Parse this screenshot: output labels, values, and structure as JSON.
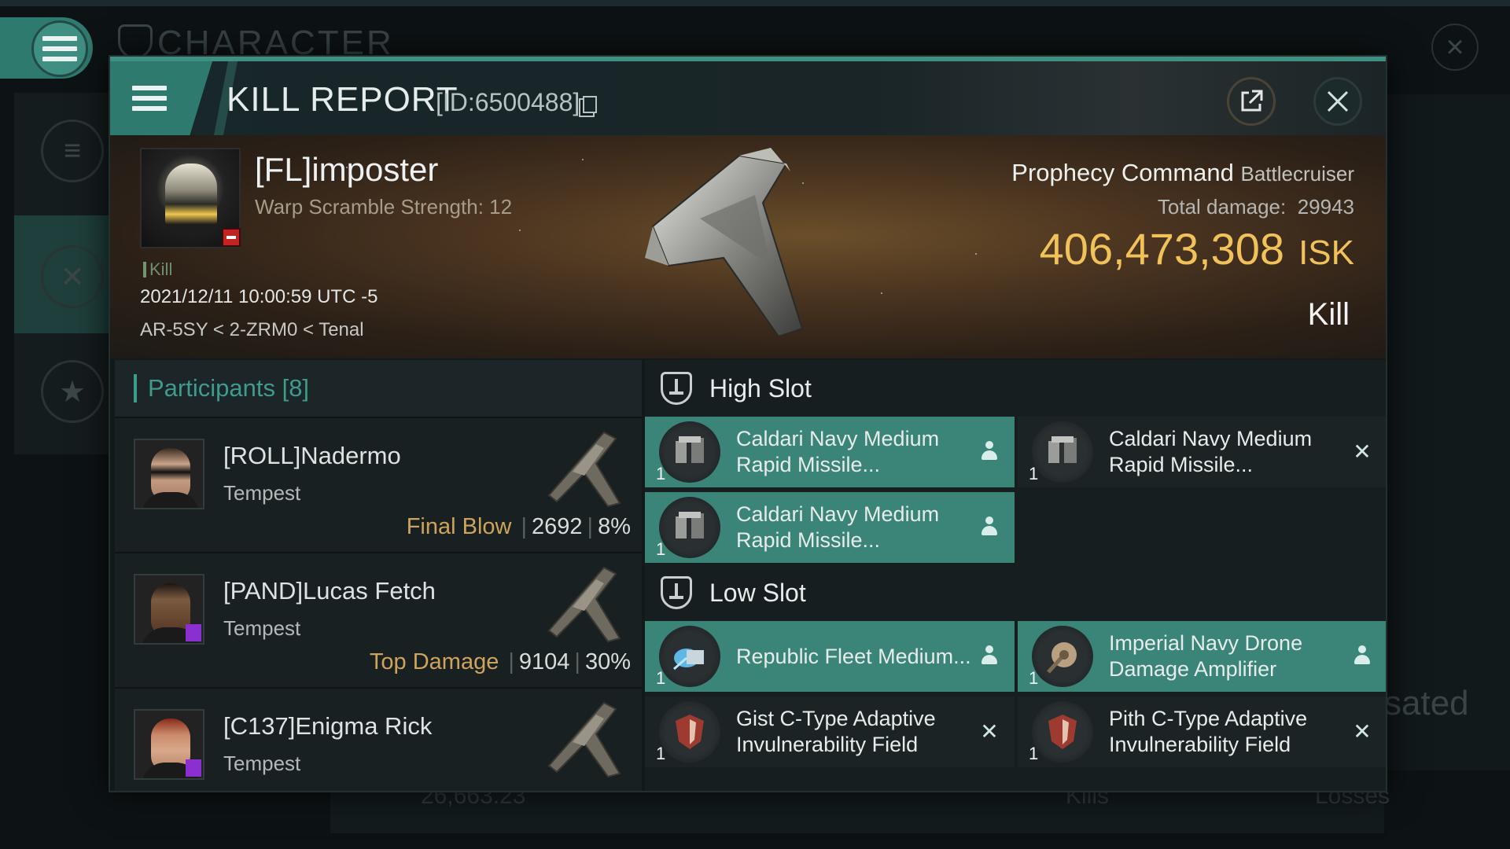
{
  "background": {
    "title": "CHARACTER",
    "right_text": "sated",
    "bottom_value": "26,663.23",
    "bottom_kills": "Kills",
    "bottom_losses": "Losses"
  },
  "header": {
    "title": "KILL REPORT",
    "id_text": "[ID:6500488]"
  },
  "victim": {
    "name": "[FL]imposter",
    "subtitle": "Warp Scramble Strength: 12",
    "tag": "Kill",
    "datetime": "2021/12/11 10:00:59 UTC -5",
    "location": "AR-5SY < 2-ZRM0 < Tenal",
    "ship_name": "Prophecy Command",
    "ship_class": "Battlecruiser",
    "total_damage_label": "Total damage:",
    "total_damage": "29943",
    "isk_value": "406,473,308",
    "isk_unit": "ISK",
    "result": "Kill"
  },
  "participants": {
    "header": "Participants [8]",
    "rows": [
      {
        "name": "[ROLL]Nadermo",
        "ship": "Tempest",
        "tag": "Final Blow",
        "damage": "2692",
        "percent": "8%"
      },
      {
        "name": "[PAND]Lucas Fetch",
        "ship": "Tempest",
        "tag": "Top Damage",
        "damage": "9104",
        "percent": "30%"
      },
      {
        "name": "[C137]Enigma Rick",
        "ship": "Tempest",
        "tag": "",
        "damage": "",
        "percent": ""
      }
    ]
  },
  "slots": {
    "high": {
      "title": "High Slot",
      "items": [
        {
          "name": "Caldari Navy Medium Rapid Missile...",
          "qty": "1",
          "state": "fitted"
        },
        {
          "name": "Caldari Navy Medium Rapid Missile...",
          "qty": "1",
          "state": "destroyed"
        },
        {
          "name": "Caldari Navy Medium Rapid Missile...",
          "qty": "1",
          "state": "fitted"
        }
      ]
    },
    "low": {
      "title": "Low Slot",
      "items": [
        {
          "name": "Republic Fleet Medium...",
          "qty": "1",
          "state": "fitted"
        },
        {
          "name": "Imperial Navy Drone Damage Amplifier",
          "qty": "1",
          "state": "fitted"
        },
        {
          "name": "Gist C-Type Adaptive Invulnerability Field",
          "qty": "1",
          "state": "destroyed"
        },
        {
          "name": "Pith C-Type Adaptive Invulnerability Field",
          "qty": "1",
          "state": "destroyed"
        }
      ]
    }
  },
  "colors": {
    "accent": "#3f8f82",
    "fitted_bg": "#3b8578",
    "isk": "#f1c25a",
    "final_blow": "#cfa45a"
  }
}
